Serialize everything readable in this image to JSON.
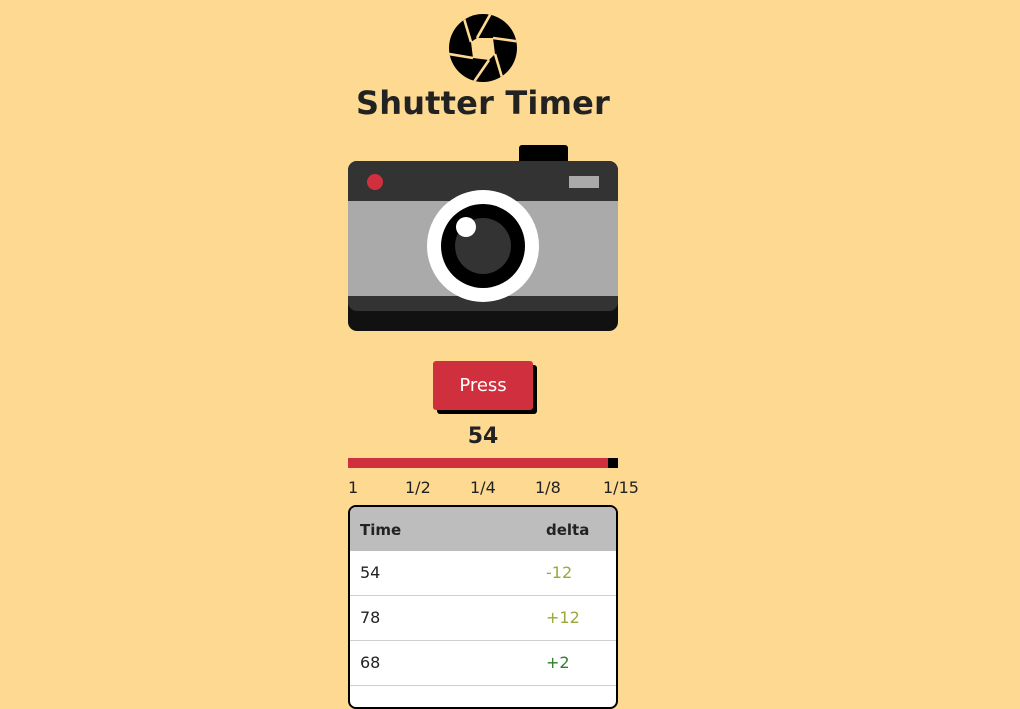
{
  "app": {
    "title": "Shutter Timer",
    "logo_icon": "aperture-icon"
  },
  "camera": {
    "icon": "camera-icon"
  },
  "controls": {
    "press_label": "Press"
  },
  "timer": {
    "value": "54",
    "progress_fraction": 0.963
  },
  "scale": {
    "labels": [
      "1",
      "1/2",
      "1/4",
      "1/8",
      "1/15"
    ]
  },
  "table": {
    "headers": [
      "Time",
      "delta"
    ],
    "rows": [
      {
        "time": "54",
        "delta": "-12"
      },
      {
        "time": "78",
        "delta": "+12"
      },
      {
        "time": "68",
        "delta": "+2"
      }
    ]
  },
  "colors": {
    "background": "#fed991",
    "accent": "#d0303e",
    "delta_olive": "#9aa83a",
    "delta_green": "#2e7d2e"
  }
}
